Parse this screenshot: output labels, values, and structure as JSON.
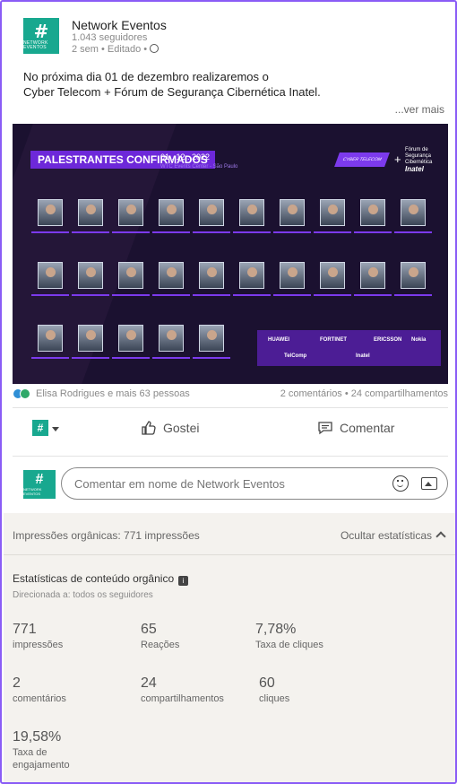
{
  "post": {
    "page_name": "Network Eventos",
    "logo_text": "NETWORK EVENTOS",
    "followers": "1.043 seguidores",
    "meta": "2 sem • Editado •",
    "text_line1": "No próxima dia 01 de dezembro realizaremos o",
    "text_line2": "Cyber Telecom + Fórum de Segurança Cibernética Inatel.",
    "see_more": "...ver mais"
  },
  "banner": {
    "title": "PALESTRANTES CONFIRMADOS",
    "date": "01 . 12 . 2022",
    "venue": "WTC Events Center - São Paulo",
    "event_logo": "CYBER TELECOM",
    "plus": "+",
    "forum_line1": "Fórum de",
    "forum_line2": "Segurança",
    "forum_line3": "Cibernética",
    "forum_line4": "Inatel",
    "sponsors": [
      "HUAWEI",
      "FORTINET",
      "ERICSSON",
      "Nokia",
      "TelComp",
      "Inatel"
    ]
  },
  "social": {
    "reactions_text": "Elisa Rodrigues e mais 63 pessoas",
    "counts_text": "2 comentários • 24 compartilhamentos"
  },
  "actions": {
    "like": "Gostei",
    "comment": "Comentar"
  },
  "comment_box": {
    "placeholder": "Comentar em nome de Network Eventos"
  },
  "stats": {
    "impressions_header": "Impressões orgânicas: 771 impressões",
    "hide_label": "Ocultar estatísticas",
    "section_title": "Estatísticas de conteúdo orgânico",
    "targeted": "Direcionada a: todos os seguidores",
    "items": [
      {
        "value": "771",
        "label": "impressões"
      },
      {
        "value": "65",
        "label": "Reações"
      },
      {
        "value": "7,78%",
        "label": "Taxa de cliques"
      },
      {
        "value": "2",
        "label": "comentários"
      },
      {
        "value": "24",
        "label": "compartilhamentos"
      },
      {
        "value": "60",
        "label": "cliques"
      },
      {
        "value": "19,58%",
        "label": "Taxa de engajamento"
      }
    ]
  },
  "colors": {
    "accent": "#8a5cf6",
    "brand": "#18a88f",
    "banner_bg": "#1b1130"
  }
}
